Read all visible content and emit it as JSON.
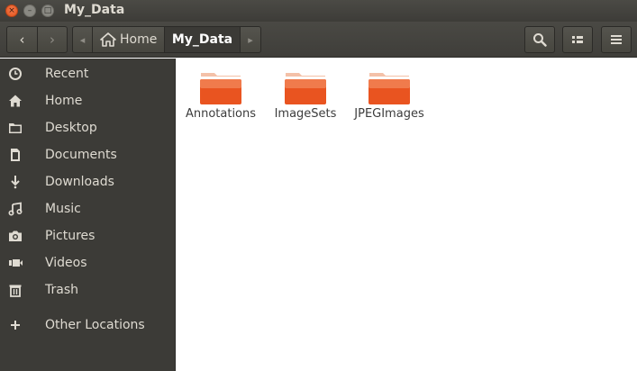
{
  "window": {
    "title": "My_Data"
  },
  "window_buttons": {
    "close": "×",
    "minimize": "–",
    "maximize": "□"
  },
  "toolbar": {
    "back": "‹",
    "forward": "›",
    "path": [
      {
        "label": "Home",
        "icon": "home-icon"
      },
      {
        "label": "My_Data"
      }
    ],
    "path_left_arrow": "◂",
    "path_right_arrow": "▸"
  },
  "sidebar": {
    "items": [
      {
        "label": "Recent",
        "icon": "clock-icon"
      },
      {
        "label": "Home",
        "icon": "home-icon"
      },
      {
        "label": "Desktop",
        "icon": "folder-icon"
      },
      {
        "label": "Documents",
        "icon": "document-icon"
      },
      {
        "label": "Downloads",
        "icon": "download-icon"
      },
      {
        "label": "Music",
        "icon": "music-icon"
      },
      {
        "label": "Pictures",
        "icon": "camera-icon"
      },
      {
        "label": "Videos",
        "icon": "video-icon"
      },
      {
        "label": "Trash",
        "icon": "trash-icon"
      },
      {
        "label": "Other Locations",
        "icon": "plus-icon"
      }
    ]
  },
  "files": [
    {
      "name": "Annotations",
      "type": "folder"
    },
    {
      "name": "ImageSets",
      "type": "folder"
    },
    {
      "name": "JPEGImages",
      "type": "folder"
    }
  ],
  "colors": {
    "folder_orange": "#e95420",
    "sidebar_bg": "#3c3b37",
    "titlebar_text": "#dfdbd2"
  }
}
